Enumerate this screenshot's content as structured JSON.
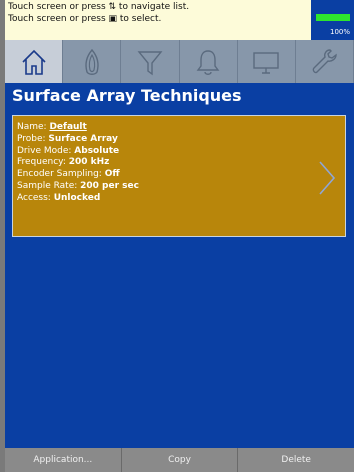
{
  "hint": {
    "line1": "Touch screen or press ⇅ to navigate list.",
    "line2": "Touch screen or press ▣ to select."
  },
  "battery": {
    "level_label": "100%",
    "level_fraction": 1.0,
    "color": "#2ee62e"
  },
  "tabs": [
    {
      "icon": "home-icon",
      "active": true
    },
    {
      "icon": "probe-icon",
      "active": false
    },
    {
      "icon": "filter-icon",
      "active": false
    },
    {
      "icon": "alarm-bell-icon",
      "active": false
    },
    {
      "icon": "display-icon",
      "active": false
    },
    {
      "icon": "wrench-icon",
      "active": false
    }
  ],
  "page": {
    "title": "Surface Array Techniques"
  },
  "technique": {
    "name_label": "Name: ",
    "name_value": "Default",
    "probe_label": "Probe: ",
    "probe_value": "Surface Array",
    "drive_label": "Drive Mode: ",
    "drive_value": "Absolute",
    "freq_label": "Frequency: ",
    "freq_value": "200 kHz",
    "enc_label": "Encoder Sampling: ",
    "enc_value": "Off",
    "rate_label": "Sample Rate: ",
    "rate_value": "200 per sec",
    "access_label": "Access: ",
    "access_value": "Unlocked"
  },
  "buttons": {
    "application": "Application...",
    "copy": "Copy",
    "delete": "Delete"
  },
  "colors": {
    "background": "#0a3fa3",
    "card": "#b8860b",
    "hint": "#fdfbd9",
    "tab": "#8797aa",
    "tab_active": "#c7ced8"
  }
}
